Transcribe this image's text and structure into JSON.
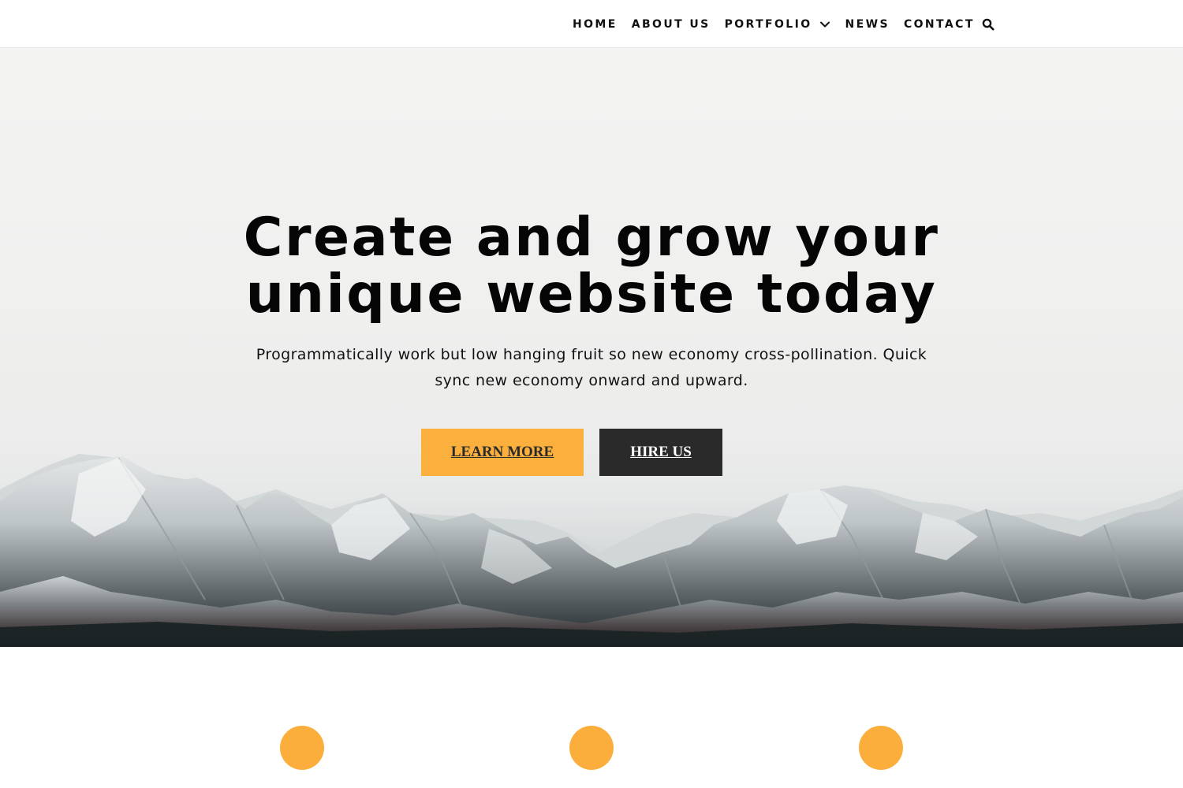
{
  "nav": {
    "items": [
      {
        "label": "HOME"
      },
      {
        "label": "ABOUT US"
      },
      {
        "label": "PORTFOLIO",
        "has_dropdown": true
      },
      {
        "label": "NEWS"
      },
      {
        "label": "CONTACT"
      }
    ],
    "search_icon": "search-icon",
    "dropdown_icon": "chevron-down-icon"
  },
  "hero": {
    "title_line1": "Create and grow your",
    "title_line2": "unique website today",
    "subtitle": "Programmatically work but low hanging fruit so new economy cross-pollination. Quick sync new economy onward and upward.",
    "buttons": {
      "learn_more": "LEARN MORE",
      "hire_us": "HIRE US"
    }
  },
  "colors": {
    "accent": "#fbae3b",
    "dark_button": "#2a2a2a",
    "text": "#050505"
  }
}
